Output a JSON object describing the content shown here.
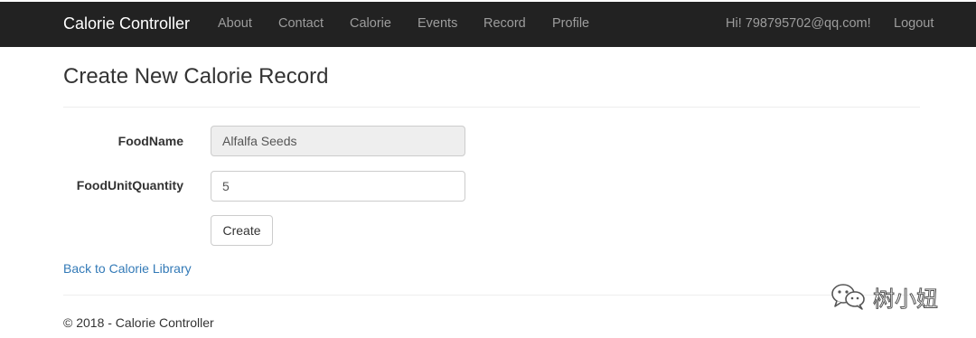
{
  "navbar": {
    "brand": "Calorie Controller",
    "links": [
      "About",
      "Contact",
      "Calorie",
      "Events",
      "Record",
      "Profile"
    ],
    "greeting": "Hi! 798795702@qq.com!",
    "logout": "Logout"
  },
  "page": {
    "title": "Create New Calorie Record"
  },
  "form": {
    "food_name_label": "FoodName",
    "food_name_value": "Alfalfa Seeds",
    "quantity_label": "FoodUnitQuantity",
    "quantity_value": "5",
    "create_label": "Create"
  },
  "back_link": "Back to Calorie Library",
  "footer": "© 2018 - Calorie Controller",
  "watermark": {
    "icon": "wechat-icon",
    "text": "树小妞"
  },
  "colors": {
    "navbar_bg": "#222222",
    "link": "#337ab7",
    "readonly_bg": "#eeeeee"
  }
}
